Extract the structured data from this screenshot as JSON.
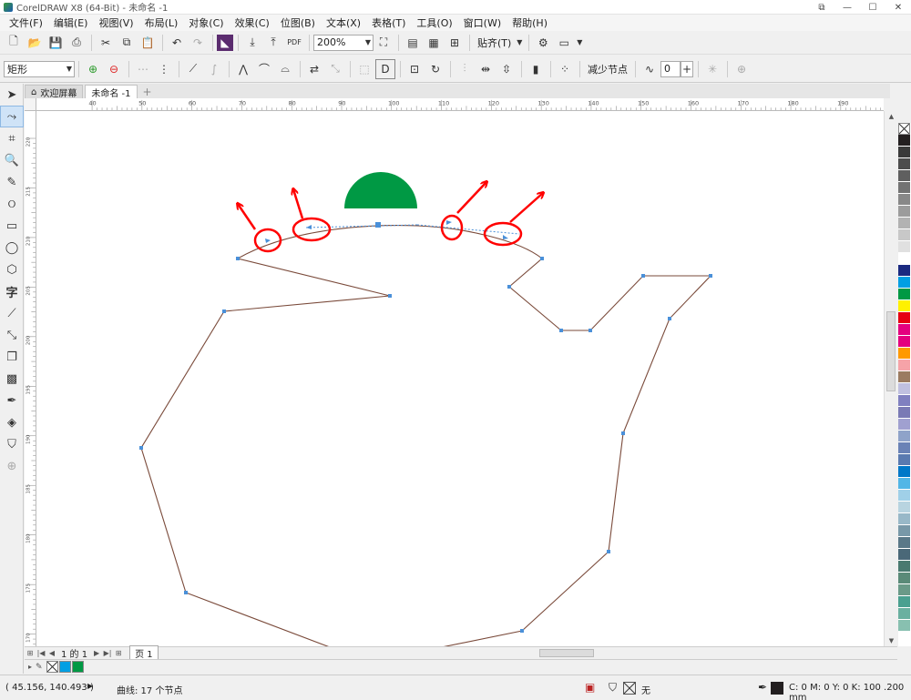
{
  "app": {
    "title": "CorelDRAW X8 (64-Bit) - 未命名 -1"
  },
  "window_controls": [
    "⧉",
    "—",
    "☐",
    "✕"
  ],
  "menu": [
    "文件(F)",
    "编辑(E)",
    "视图(V)",
    "布局(L)",
    "对象(C)",
    "效果(C)",
    "位图(B)",
    "文本(X)",
    "表格(T)",
    "工具(O)",
    "窗口(W)",
    "帮助(H)"
  ],
  "toolbar1": {
    "zoom": "200%",
    "snap_label": "贴齐(T)",
    "pdf_label": "PDF"
  },
  "toolbar2": {
    "shape_combo": "矩形",
    "reduce_nodes": "减少节点",
    "curve_smoothness": "0"
  },
  "tabs": {
    "welcome": "欢迎屏幕",
    "document": "未命名 -1",
    "add": "+"
  },
  "ruler_h_labels": [
    "40",
    "50",
    "60",
    "70",
    "80",
    "90",
    "100",
    "110",
    "120",
    "130",
    "140",
    "150",
    "160",
    "170",
    "180",
    "190"
  ],
  "ruler_v_labels": [
    "220",
    "215",
    "210",
    "205",
    "200",
    "195",
    "190",
    "185",
    "180",
    "175",
    "170"
  ],
  "page_nav": {
    "page_count": "1 的 1",
    "page_tab": "页 1"
  },
  "statusbar": {
    "coordinates": "( 45.156, 140.493 )",
    "object_info": "曲线: 17 个节点",
    "fill": "无",
    "outline": "C: 0 M: 0 Y: 0 K: 100 .200 mm"
  },
  "colors": {
    "path_stroke": "#7a4a3a",
    "node": "#4a90d9",
    "annotation": "#ff0000",
    "green_shape": "#009944"
  },
  "palette": [
    "#ffffff",
    "#231f20",
    "#3a3a3a",
    "#4d4d4d",
    "#5f5f5f",
    "#737373",
    "#888888",
    "#9c9c9c",
    "#b2b2b2",
    "#c8c8c8",
    "#e0e0e0",
    "#ffffff",
    "#1b2a80",
    "#009fe3",
    "#009944",
    "#fff100",
    "#e60012",
    "#e4007f",
    "#e4007f",
    "#ff9900",
    "#f6a3a8",
    "#9b7b61",
    "#c0c0e0",
    "#8080c0",
    "#7a7ab5",
    "#a0a0d0",
    "#8fa3c9",
    "#6a82b6",
    "#5a7ab0",
    "#0078c8",
    "#52b6e6",
    "#a0d0e8",
    "#b8d4e0",
    "#98b8c8",
    "#7898a8",
    "#5a7888",
    "#4a6878",
    "#4a7a70",
    "#5a8a78",
    "#6a9a88",
    "#4aa090",
    "#6ab0a0",
    "#88c0b0"
  ]
}
